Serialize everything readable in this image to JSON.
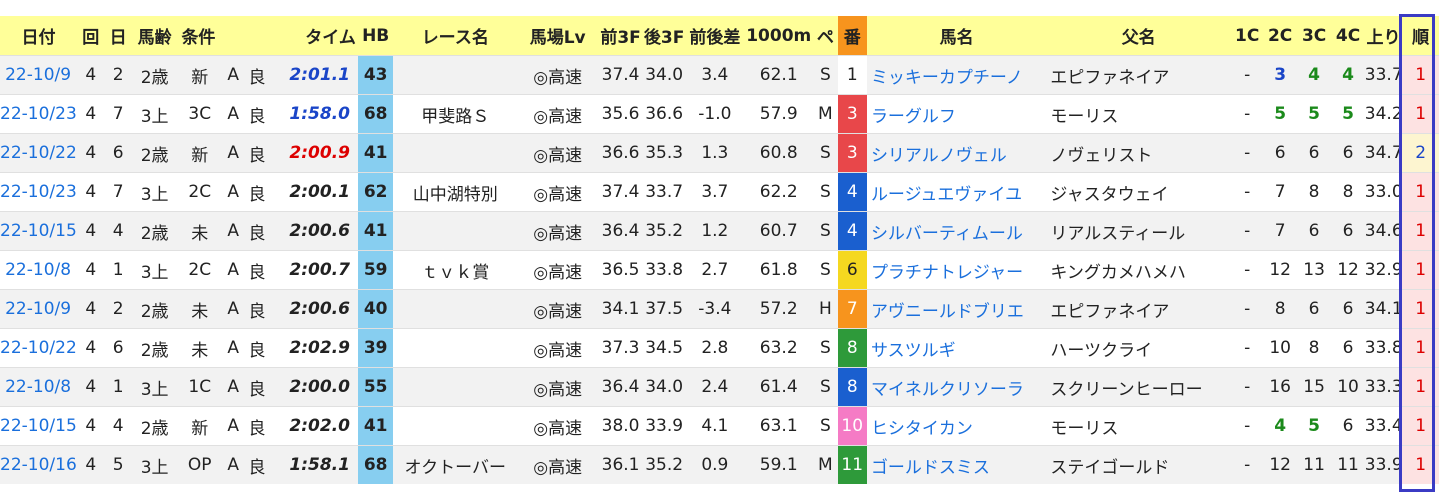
{
  "headers": {
    "date": "日付",
    "kai": "回",
    "nichi": "日",
    "age": "馬齢",
    "cond": "条件",
    "time": "タイム",
    "hb": "HB",
    "race": "レース名",
    "baba": "馬場Lv",
    "f3": "前3F",
    "l3": "後3F",
    "diff": "前後差",
    "m1000": "1000m",
    "pace": "ペ",
    "ban": "番",
    "horse": "馬名",
    "sire": "父名",
    "c1": "1C",
    "c2": "2C",
    "c3": "3C",
    "c4": "4C",
    "agari": "上り",
    "rank": "順"
  },
  "colors": {
    "header_bg": "#ffff99",
    "hb_bg": "#87cef0",
    "link": "#1a6fdc",
    "rank_frame": "#3b3bc4",
    "rank_bg": "#fde2e2",
    "time_blue": "#1a45c8",
    "time_red": "#dd0000",
    "pos_green": "#1b8a1b"
  },
  "rows": [
    {
      "date": "22-10/9",
      "kai": "4",
      "nichi": "2",
      "age": "2歳",
      "cond": "新",
      "grade": "A",
      "track": "良",
      "time": "2:01.1",
      "time_color": "#1a45c8",
      "hb": "43",
      "race": "",
      "baba": "◎高速",
      "f3": "37.4",
      "l3": "34.0",
      "diff": "3.4",
      "m1000": "62.1",
      "pace": "S",
      "ban": "1",
      "ban_bg": "#ffffff",
      "ban_fg": "#222222",
      "horse": "ミッキーカプチーノ",
      "sire": "エピファネイア",
      "c1": "-",
      "c2": "3",
      "c2c": "pos-blue",
      "c3": "4",
      "c3c": "pos-green",
      "c4": "4",
      "c4c": "pos-green",
      "agari": "33.7",
      "rank": "1"
    },
    {
      "date": "22-10/23",
      "kai": "4",
      "nichi": "7",
      "age": "3上",
      "cond": "3C",
      "grade": "A",
      "track": "良",
      "time": "1:58.0",
      "time_color": "#1a45c8",
      "hb": "68",
      "race": "甲斐路Ｓ",
      "baba": "◎高速",
      "f3": "35.6",
      "l3": "36.6",
      "diff": "-1.0",
      "m1000": "57.9",
      "pace": "M",
      "ban": "3",
      "ban_bg": "#e8474a",
      "ban_fg": "#ffffff",
      "horse": "ラーグルフ",
      "sire": "モーリス",
      "c1": "-",
      "c2": "5",
      "c2c": "pos-green",
      "c3": "5",
      "c3c": "pos-green",
      "c4": "5",
      "c4c": "pos-green",
      "agari": "34.2",
      "rank": "1"
    },
    {
      "date": "22-10/22",
      "kai": "4",
      "nichi": "6",
      "age": "2歳",
      "cond": "新",
      "grade": "A",
      "track": "良",
      "time": "2:00.9",
      "time_color": "#dd0000",
      "hb": "41",
      "race": "",
      "baba": "◎高速",
      "f3": "36.6",
      "l3": "35.3",
      "diff": "1.3",
      "m1000": "60.8",
      "pace": "S",
      "ban": "3",
      "ban_bg": "#e8474a",
      "ban_fg": "#ffffff",
      "horse": "シリアルノヴェル",
      "sire": "ノヴェリスト",
      "c1": "-",
      "c2": "6",
      "c2c": "",
      "c3": "6",
      "c3c": "",
      "c4": "6",
      "c4c": "",
      "agari": "34.7",
      "rank": "2"
    },
    {
      "date": "22-10/23",
      "kai": "4",
      "nichi": "7",
      "age": "3上",
      "cond": "2C",
      "grade": "A",
      "track": "良",
      "time": "2:00.1",
      "time_color": "#222222",
      "hb": "62",
      "race": "山中湖特別",
      "baba": "◎高速",
      "f3": "37.4",
      "l3": "33.7",
      "diff": "3.7",
      "m1000": "62.2",
      "pace": "S",
      "ban": "4",
      "ban_bg": "#1a5fcf",
      "ban_fg": "#ffffff",
      "horse": "ルージュエヴァイユ",
      "sire": "ジャスタウェイ",
      "c1": "-",
      "c2": "7",
      "c2c": "",
      "c3": "8",
      "c3c": "",
      "c4": "8",
      "c4c": "",
      "agari": "33.0",
      "rank": "1"
    },
    {
      "date": "22-10/15",
      "kai": "4",
      "nichi": "4",
      "age": "2歳",
      "cond": "未",
      "grade": "A",
      "track": "良",
      "time": "2:00.6",
      "time_color": "#222222",
      "hb": "41",
      "race": "",
      "baba": "◎高速",
      "f3": "36.4",
      "l3": "35.2",
      "diff": "1.2",
      "m1000": "60.7",
      "pace": "S",
      "ban": "4",
      "ban_bg": "#1a5fcf",
      "ban_fg": "#ffffff",
      "horse": "シルバーティムール",
      "sire": "リアルスティール",
      "c1": "-",
      "c2": "7",
      "c2c": "",
      "c3": "6",
      "c3c": "",
      "c4": "6",
      "c4c": "",
      "agari": "34.6",
      "rank": "1"
    },
    {
      "date": "22-10/8",
      "kai": "4",
      "nichi": "1",
      "age": "3上",
      "cond": "2C",
      "grade": "A",
      "track": "良",
      "time": "2:00.7",
      "time_color": "#222222",
      "hb": "59",
      "race": "ｔｖｋ賞",
      "baba": "◎高速",
      "f3": "36.5",
      "l3": "33.8",
      "diff": "2.7",
      "m1000": "61.8",
      "pace": "S",
      "ban": "6",
      "ban_bg": "#f5d820",
      "ban_fg": "#222222",
      "horse": "プラチナトレジャー",
      "sire": "キングカメハメハ",
      "c1": "-",
      "c2": "12",
      "c2c": "",
      "c3": "13",
      "c3c": "",
      "c4": "12",
      "c4c": "",
      "agari": "32.9",
      "rank": "1"
    },
    {
      "date": "22-10/9",
      "kai": "4",
      "nichi": "2",
      "age": "2歳",
      "cond": "未",
      "grade": "A",
      "track": "良",
      "time": "2:00.6",
      "time_color": "#222222",
      "hb": "40",
      "race": "",
      "baba": "◎高速",
      "f3": "34.1",
      "l3": "37.5",
      "diff": "-3.4",
      "m1000": "57.2",
      "pace": "H",
      "ban": "7",
      "ban_bg": "#f7941d",
      "ban_fg": "#ffffff",
      "horse": "アヴニールドブリエ",
      "sire": "エピファネイア",
      "c1": "-",
      "c2": "8",
      "c2c": "",
      "c3": "6",
      "c3c": "",
      "c4": "6",
      "c4c": "",
      "agari": "34.1",
      "rank": "1"
    },
    {
      "date": "22-10/22",
      "kai": "4",
      "nichi": "6",
      "age": "2歳",
      "cond": "未",
      "grade": "A",
      "track": "良",
      "time": "2:02.9",
      "time_color": "#222222",
      "hb": "39",
      "race": "",
      "baba": "◎高速",
      "f3": "37.3",
      "l3": "34.5",
      "diff": "2.8",
      "m1000": "63.2",
      "pace": "S",
      "ban": "8",
      "ban_bg": "#2e9a3a",
      "ban_fg": "#ffffff",
      "horse": "サスツルギ",
      "sire": "ハーツクライ",
      "c1": "-",
      "c2": "10",
      "c2c": "",
      "c3": "8",
      "c3c": "",
      "c4": "6",
      "c4c": "",
      "agari": "33.8",
      "rank": "1"
    },
    {
      "date": "22-10/8",
      "kai": "4",
      "nichi": "1",
      "age": "3上",
      "cond": "1C",
      "grade": "A",
      "track": "良",
      "time": "2:00.0",
      "time_color": "#222222",
      "hb": "55",
      "race": "",
      "baba": "◎高速",
      "f3": "36.4",
      "l3": "34.0",
      "diff": "2.4",
      "m1000": "61.4",
      "pace": "S",
      "ban": "8",
      "ban_bg": "#1a5fcf",
      "ban_fg": "#ffffff",
      "horse": "マイネルクリソーラ",
      "sire": "スクリーンヒーロー",
      "c1": "-",
      "c2": "16",
      "c2c": "",
      "c3": "15",
      "c3c": "",
      "c4": "10",
      "c4c": "",
      "agari": "33.3",
      "rank": "1"
    },
    {
      "date": "22-10/15",
      "kai": "4",
      "nichi": "4",
      "age": "2歳",
      "cond": "新",
      "grade": "A",
      "track": "良",
      "time": "2:02.0",
      "time_color": "#222222",
      "hb": "41",
      "race": "",
      "baba": "◎高速",
      "f3": "38.0",
      "l3": "33.9",
      "diff": "4.1",
      "m1000": "63.1",
      "pace": "S",
      "ban": "10",
      "ban_bg": "#f57bc5",
      "ban_fg": "#ffffff",
      "horse": "ヒシタイカン",
      "sire": "モーリス",
      "c1": "-",
      "c2": "4",
      "c2c": "pos-green",
      "c3": "5",
      "c3c": "pos-green",
      "c4": "6",
      "c4c": "",
      "agari": "33.4",
      "rank": "1"
    },
    {
      "date": "22-10/16",
      "kai": "4",
      "nichi": "5",
      "age": "3上",
      "cond": "OP",
      "grade": "A",
      "track": "良",
      "time": "1:58.1",
      "time_color": "#222222",
      "hb": "68",
      "race": "オクトーバー",
      "baba": "◎高速",
      "f3": "36.1",
      "l3": "35.2",
      "diff": "0.9",
      "m1000": "59.1",
      "pace": "M",
      "ban": "11",
      "ban_bg": "#2e9a3a",
      "ban_fg": "#ffffff",
      "horse": "ゴールドスミス",
      "sire": "ステイゴールド",
      "c1": "-",
      "c2": "12",
      "c2c": "",
      "c3": "11",
      "c3c": "",
      "c4": "11",
      "c4c": "",
      "agari": "33.9",
      "rank": "1"
    }
  ]
}
